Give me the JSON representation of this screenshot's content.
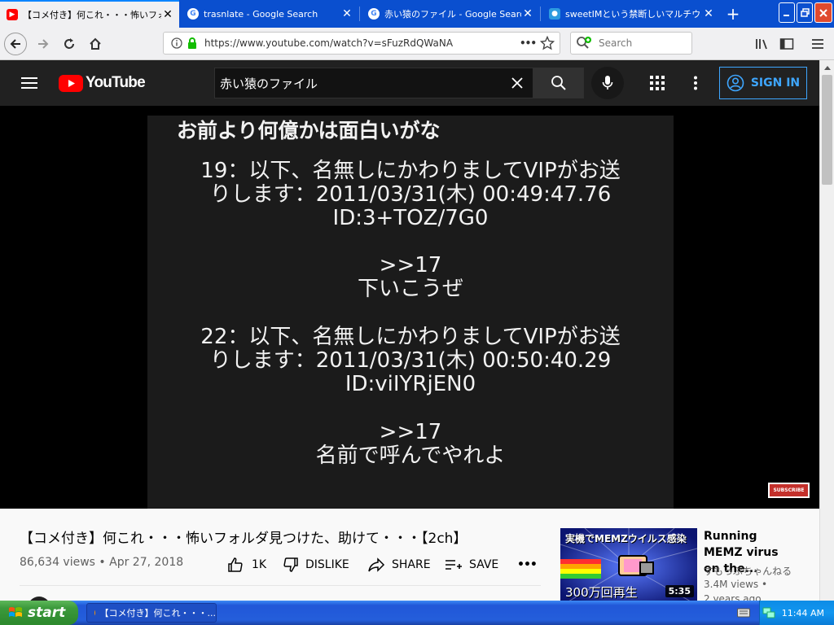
{
  "browser": {
    "tabs": [
      {
        "title": "【コメ付き】何これ・・・怖いフォルダ",
        "favicon": "youtube-favicon",
        "active": true
      },
      {
        "title": "trasnlate - Google Search",
        "favicon": "google-favicon",
        "active": false
      },
      {
        "title": "赤い猿のファイル - Google Search",
        "favicon": "google-favicon",
        "active": false
      },
      {
        "title": "sweetIMという禁断しいマルチウェ",
        "favicon": "page-favicon",
        "active": false
      }
    ],
    "close_glyph": "✕",
    "new_tab_glyph": "+",
    "url": "https://www.youtube.com/watch?v=sFuzRdQWaNA",
    "page_actions_glyph": "•••",
    "search_placeholder": "Search"
  },
  "youtube": {
    "logo_text": "YouTube",
    "search_value": "赤い猿のファイル",
    "sign_in_label": "SIGN IN",
    "video_text": [
      "お前より何億かは面白いがな",
      "19：以下、名無しにかわりましてVIPがお送",
      "りします：2011/03/31(木) 00:49:47.76",
      "ID:3+TOZ/7G0",
      ">>17",
      "下いこうぜ",
      "22：以下、名無しにかわりましてVIPがお送",
      "りします：2011/03/31(木) 00:50:40.29",
      "ID:viIYRjEN0",
      ">>17",
      "名前で呼んでやれよ"
    ],
    "subscribe_badge": "SUBSCRIBE",
    "video_title": "【コメ付き】何これ・・・怖いフォルダ見つけた、助けて・・・【2ch】",
    "views": "86,634 views",
    "date": "Apr 27, 2018",
    "meta_sep": "•",
    "like_count": "1K",
    "dislike_label": "DISLIKE",
    "share_label": "SHARE",
    "save_label": "SAVE",
    "more_glyph": "•••",
    "related": {
      "thumb_text_top": "実機でMEMZウイルス感染",
      "thumb_text_bottom": "300万回再生",
      "duration": "5:35",
      "title": "Running MEMZ virus on the...",
      "channel": "すもっぷちゃんねる",
      "views": "3.4M views •",
      "age": "2 years ago"
    }
  },
  "taskbar": {
    "start_label": "start",
    "task_label": "【コメ付き】何これ・・・...",
    "clock": "11:44 AM"
  },
  "colors": {
    "titlebar": "#0a4fcf",
    "youtube_red": "#ff0000",
    "signin_blue": "#3ea6ff",
    "taskbar_blue": "#245edb",
    "start_green": "#3c9a3c"
  }
}
